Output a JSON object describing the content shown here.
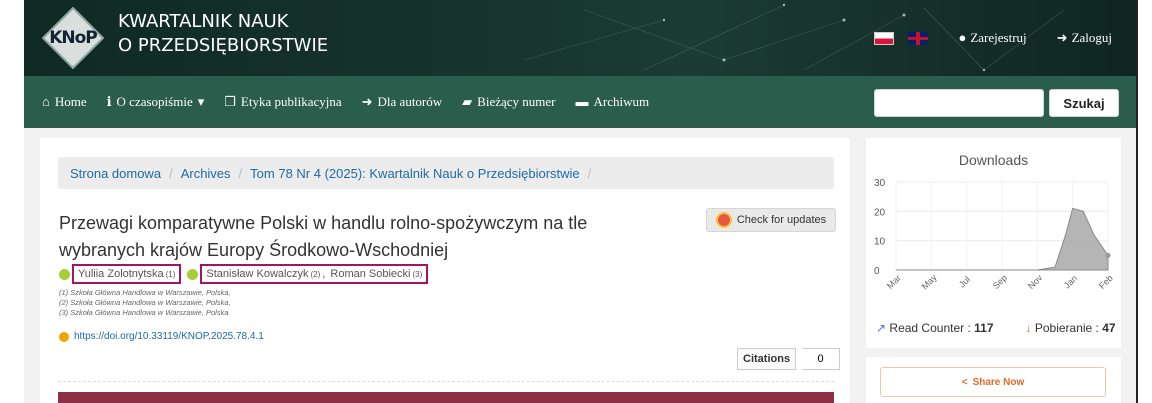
{
  "header": {
    "logo_text": "KNoP",
    "title_line1": "KWARTALNIK NAUK",
    "title_line2": "O PRZEDSIĘBIORSTWIE",
    "register": "Zarejestruj",
    "login": "Zaloguj"
  },
  "nav": {
    "items": [
      {
        "label": "Home",
        "icon": "home-icon"
      },
      {
        "label": "O czasopiśmie",
        "icon": "info-icon",
        "dropdown": true
      },
      {
        "label": "Etyka publikacyjna",
        "icon": "copy-icon"
      },
      {
        "label": "Dla autorów",
        "icon": "sign-in-icon"
      },
      {
        "label": "Bieżący numer",
        "icon": "book-icon"
      },
      {
        "label": "Archiwum",
        "icon": "archive-icon"
      }
    ],
    "search_value": "",
    "search_button": "Szukaj"
  },
  "breadcrumb": [
    "Strona domowa",
    "Archives",
    "Tom 78 Nr 4 (2025): Kwartalnik Nauk o Przedsiębiorstwie"
  ],
  "article": {
    "title": "Przewagi komparatywne Polski w handlu rolno-spożywczym na tle wybranych krajów Europy Środkowo-Wschodniej",
    "check_updates": "Check for updates",
    "authors": [
      {
        "name": "Yuliia Zolotnytska",
        "sup": "(1)"
      },
      {
        "name": "Stanisław Kowalczyk",
        "sup": "(2)"
      },
      {
        "name": "Roman Sobiecki",
        "sup": "(3)"
      }
    ],
    "affiliations": [
      "(1) Szkoła Główna Handlowa w Warszawie, Polska,",
      "(2) Szkoła Główna Handlowa w Warszawie, Polska,",
      "(3) Szkoła Główna Handlowa w Warszawie, Polska"
    ],
    "doi": "https://doi.org/10.33119/KNOP.2025.78.4.1",
    "citations_label": "Citations",
    "citations_count": "0"
  },
  "sidebar": {
    "downloads_title": "Downloads",
    "read_counter_label": "Read Counter :",
    "read_counter_value": "117",
    "downloads_label": "Pobieranie :",
    "downloads_value": "47",
    "share_label": "Share Now"
  },
  "chart_data": {
    "type": "area",
    "title": "Downloads",
    "categories": [
      "Mar",
      "May",
      "Jul",
      "Sep",
      "Nov",
      "Jan",
      "Feb"
    ],
    "y_ticks": [
      0,
      10,
      20,
      30
    ],
    "ylim": [
      0,
      30
    ],
    "x": [
      0,
      1,
      2,
      3,
      4,
      4.5,
      4.8,
      5.0,
      5.3,
      5.6,
      6
    ],
    "values": [
      0,
      0,
      0,
      0,
      0,
      1,
      12,
      21,
      20,
      12,
      5
    ],
    "color": "#a8a8a8",
    "grid": true
  },
  "colors": {
    "header_bg": "#15322b",
    "nav_bg": "#2a5d4c",
    "link": "#1f6aa5",
    "author_highlight": "#a21560",
    "banner": "#8d2f42",
    "share": "#e06b2a"
  }
}
